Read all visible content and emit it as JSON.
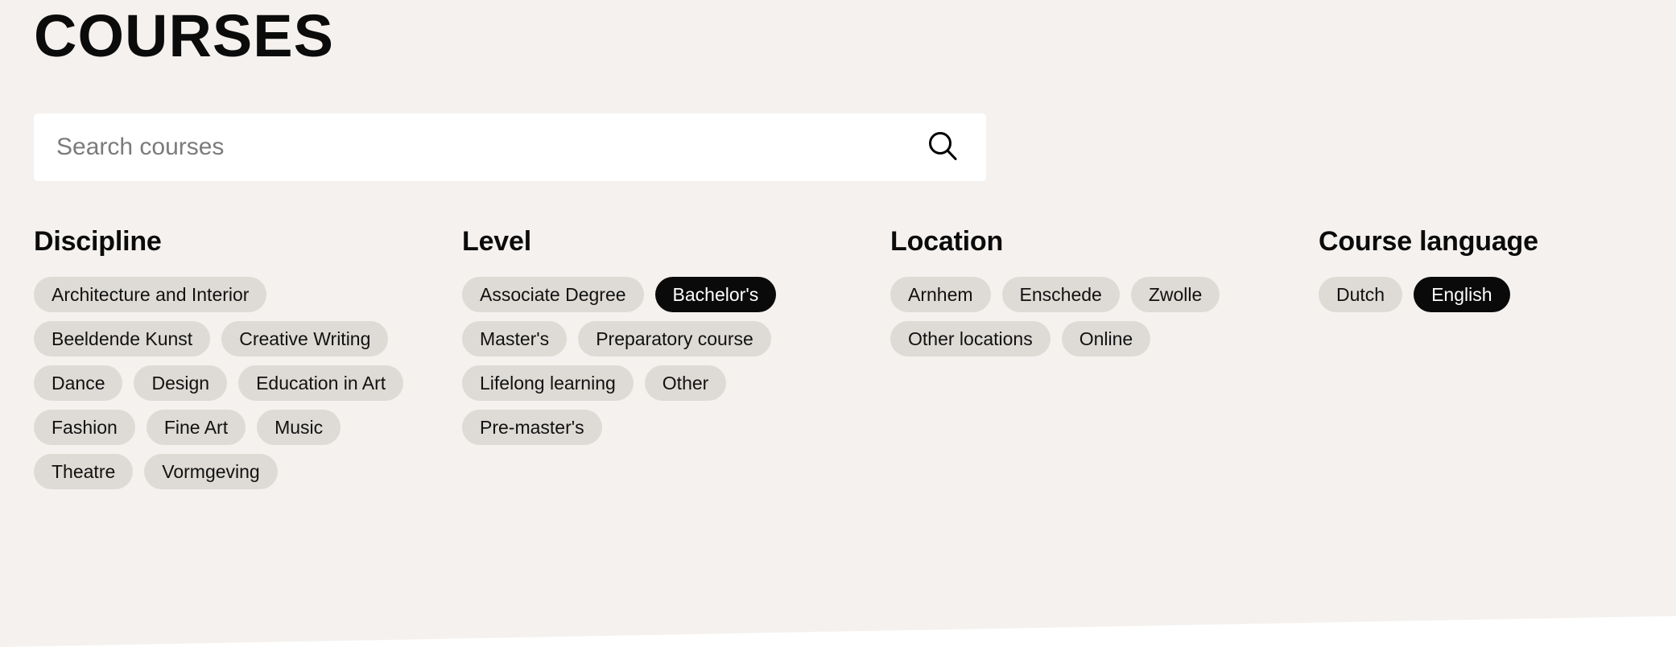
{
  "page": {
    "title": "COURSES",
    "background_color": "#f4f1ee",
    "panel_below_color": "#ffffff",
    "chip_color": "#dedbd6",
    "chip_selected_color": "#0a0a0a",
    "text_color": "#0b0b0b"
  },
  "search": {
    "placeholder": "Search courses",
    "value": "",
    "icon": "search-icon"
  },
  "filters": [
    {
      "id": "discipline",
      "title": "Discipline",
      "chips": [
        {
          "label": "Architecture and Interior",
          "selected": false
        },
        {
          "label": "Beeldende Kunst",
          "selected": false
        },
        {
          "label": "Creative Writing",
          "selected": false
        },
        {
          "label": "Dance",
          "selected": false
        },
        {
          "label": "Design",
          "selected": false
        },
        {
          "label": "Education in Art",
          "selected": false
        },
        {
          "label": "Fashion",
          "selected": false
        },
        {
          "label": "Fine Art",
          "selected": false
        },
        {
          "label": "Music",
          "selected": false
        },
        {
          "label": "Theatre",
          "selected": false
        },
        {
          "label": "Vormgeving",
          "selected": false
        }
      ]
    },
    {
      "id": "level",
      "title": "Level",
      "chips": [
        {
          "label": "Associate Degree",
          "selected": false
        },
        {
          "label": "Bachelor's",
          "selected": true
        },
        {
          "label": "Master's",
          "selected": false
        },
        {
          "label": "Preparatory course",
          "selected": false
        },
        {
          "label": "Lifelong learning",
          "selected": false
        },
        {
          "label": "Other",
          "selected": false
        },
        {
          "label": "Pre-master's",
          "selected": false
        }
      ]
    },
    {
      "id": "location",
      "title": "Location",
      "chips": [
        {
          "label": "Arnhem",
          "selected": false
        },
        {
          "label": "Enschede",
          "selected": false
        },
        {
          "label": "Zwolle",
          "selected": false
        },
        {
          "label": "Other locations",
          "selected": false
        },
        {
          "label": "Online",
          "selected": false
        }
      ]
    },
    {
      "id": "language",
      "title": "Course language",
      "chips": [
        {
          "label": "Dutch",
          "selected": false
        },
        {
          "label": "English",
          "selected": true
        }
      ]
    }
  ]
}
